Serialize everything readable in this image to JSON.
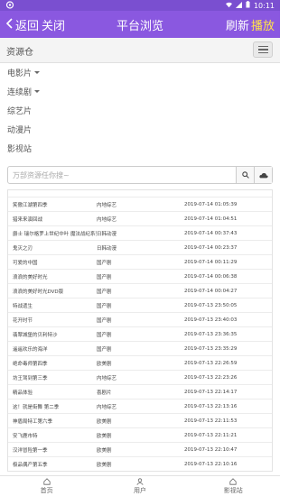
{
  "statusbar": {
    "time": "10:11"
  },
  "appbar": {
    "back_label": "返回",
    "close_label": "关闭",
    "title": "平台浏览",
    "refresh_label": "刷新",
    "play_label": "播放"
  },
  "site": {
    "name": "资源仓"
  },
  "nav": {
    "items": [
      {
        "label": "电影片",
        "dropdown": true
      },
      {
        "label": "连续剧",
        "dropdown": true
      },
      {
        "label": "综艺片",
        "dropdown": false
      },
      {
        "label": "动漫片",
        "dropdown": false
      },
      {
        "label": "影视站",
        "dropdown": false
      }
    ]
  },
  "search": {
    "placeholder": "万部资源任你搜~"
  },
  "table": {
    "rows": [
      [
        "笑傲江湖第四季",
        "内地综艺",
        "2019-07-14 01:05:39"
      ],
      [
        "猎来来演回战",
        "内地综艺",
        "2019-07-14 01:04:51"
      ],
      [
        "爵士 瑞尔格罗上世纪中叶 魔法战纪系列",
        "日韩动漫",
        "2019-07-14 00:37:43"
      ],
      [
        "鬼灭之刃",
        "日韩动漫",
        "2019-07-14 00:23:37"
      ],
      [
        "可爱的中国",
        "国产剧",
        "2019-07-14 00:11:29"
      ],
      [
        "浪浪的美好时光",
        "国产剧",
        "2019-07-14 00:06:38"
      ],
      [
        "浪浪的美好时光DVD版",
        "国产剧",
        "2019-07-14 00:04:27"
      ],
      [
        "特战遗生",
        "国产剧",
        "2019-07-13 23:50:05"
      ],
      [
        "花开时节",
        "国产剧",
        "2019-07-13 23:40:03"
      ],
      [
        "翡翠城堡的贝利特沙",
        "国产剧",
        "2019-07-13 23:36:35"
      ],
      [
        "遥遥欢乐的海洋",
        "国产剧",
        "2019-07-13 23:35:29"
      ],
      [
        "绝命毒师第四季",
        "欧美剧",
        "2019-07-13 22:26:59"
      ],
      [
        "坊王驾到第三季",
        "内地综艺",
        "2019-07-13 22:23:26"
      ],
      [
        "精品体验",
        "喜剧片",
        "2019-07-13 22:14:17"
      ],
      [
        "这！就是街舞 第二季",
        "内地综艺",
        "2019-07-13 22:13:16"
      ],
      [
        "神盾局特工第六季",
        "欧美剧",
        "2019-07-13 22:11:53"
      ],
      [
        "安飞鹿市特",
        "欧美剧",
        "2019-07-13 22:11:21"
      ],
      [
        "汉洋冒险第一季",
        "欧美剧",
        "2019-07-13 22:10:47"
      ],
      [
        "极品偶产第五季",
        "欧美剧",
        "2019-07-13 22:10:16"
      ]
    ]
  },
  "bottomnav": {
    "tabs": [
      {
        "label": "首页",
        "icon": "home-icon"
      },
      {
        "label": "用户",
        "icon": "user-icon"
      },
      {
        "label": "影视站",
        "icon": "home-icon"
      }
    ]
  }
}
